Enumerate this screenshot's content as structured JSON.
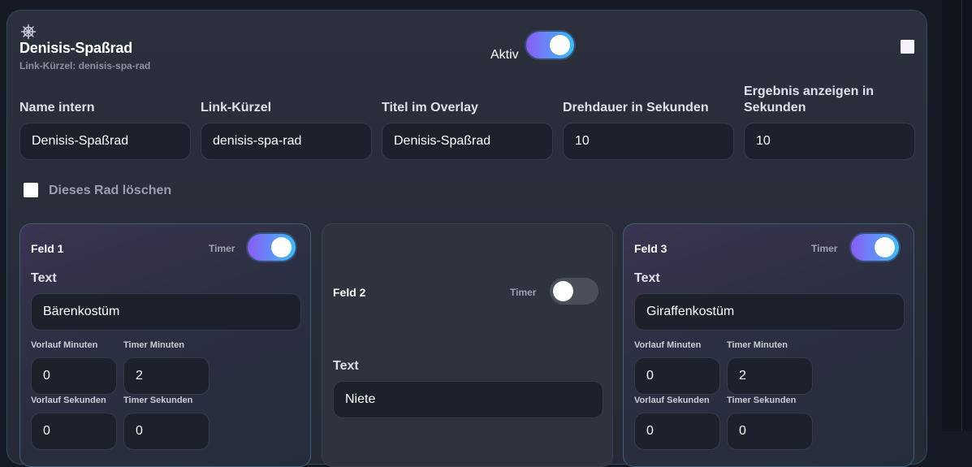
{
  "wheel": {
    "icon": "ship-wheel-icon",
    "title": "Denisis-Spaßrad",
    "slug_line": "Link-Kürzel: denisis-spa-rad",
    "active_label": "Aktiv",
    "active": true
  },
  "fields": {
    "name_intern": {
      "label": "Name intern",
      "value": "Denisis-Spaßrad"
    },
    "link_kuerzel": {
      "label": "Link-Kürzel",
      "value": "denisis-spa-rad"
    },
    "titel_overlay": {
      "label": "Titel im Overlay",
      "value": "Denisis-Spaßrad"
    },
    "drehdauer": {
      "label": "Drehdauer in Sekunden",
      "value": "10"
    },
    "ergebnis": {
      "label": "Ergebnis anzeigen in Sekunden",
      "value": "10"
    }
  },
  "delete": {
    "label": "Dieses Rad löschen",
    "checked": false
  },
  "segments": [
    {
      "title": "Feld 1",
      "timer_label": "Timer",
      "timer_on": true,
      "text_label": "Text",
      "text_value": "Bärenkostüm",
      "vorlauf_min_label": "Vorlauf Minuten",
      "vorlauf_min": "0",
      "timer_min_label": "Timer Minuten",
      "timer_min": "2",
      "vorlauf_sek_label": "Vorlauf Sekunden",
      "vorlauf_sek": "0",
      "timer_sek_label": "Timer Sekunden",
      "timer_sek": "0"
    },
    {
      "title": "Feld 2",
      "timer_label": "Timer",
      "timer_on": false,
      "text_label": "Text",
      "text_value": "Niete"
    },
    {
      "title": "Feld 3",
      "timer_label": "Timer",
      "timer_on": true,
      "text_label": "Text",
      "text_value": "Giraffenkostüm",
      "vorlauf_min_label": "Vorlauf Minuten",
      "vorlauf_min": "0",
      "timer_min_label": "Timer Minuten",
      "timer_min": "2",
      "vorlauf_sek_label": "Vorlauf Sekunden",
      "vorlauf_sek": "0",
      "timer_sek_label": "Timer Sekunden",
      "timer_sek": "0"
    }
  ],
  "colors": {
    "accent_start": "#8b5cf6",
    "accent_end": "#38bdf8",
    "card_border": "#2e4d5f"
  }
}
